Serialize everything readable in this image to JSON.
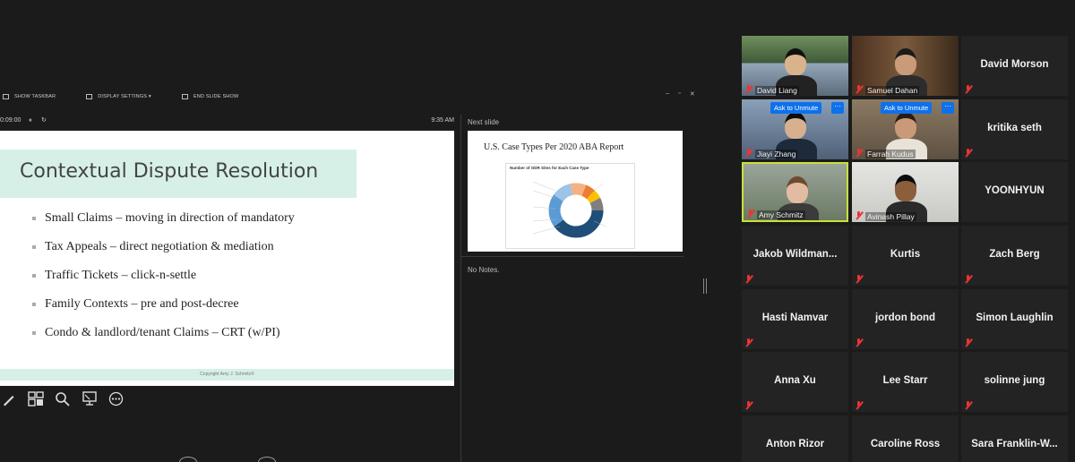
{
  "presenter": {
    "toolbar": {
      "show_taskbar": "SHOW TASKBAR",
      "display_settings": "DISPLAY SETTINGS ▾",
      "end_slide_show": "END SLIDE SHOW",
      "window_controls": [
        "–",
        "▫",
        "✕"
      ]
    },
    "timer": {
      "elapsed": "0:09:00",
      "pause_icon": "⏸",
      "reset_icon": "↻",
      "clock": "9:35 AM"
    },
    "current_slide": {
      "title": "Contextual Dispute Resolution",
      "bullets": [
        "Small Claims – moving in direction of mandatory",
        "Tax Appeals – direct negotiation & mediation",
        "Traffic Tickets – click-n-settle",
        "Family Contexts – pre and post-decree",
        "Condo & landlord/tenant Claims – CRT (w/PI)"
      ],
      "footer": "Copyright Amy J. Schmitz©"
    },
    "tools": [
      "pen-icon",
      "slides-grid-icon",
      "zoom-icon",
      "pointer-icon",
      "more-icon"
    ],
    "next_slide_label": "Next slide",
    "next_slide": {
      "title": "U.S. Case Types Per 2020 ABA Report",
      "chart_title": "Number of ODR Sites for Each Case Type"
    },
    "notes": "No Notes."
  },
  "participants": [
    {
      "name": "David Liang",
      "video": true,
      "muted": true
    },
    {
      "name": "Samuel Dahan",
      "video": true,
      "muted": true
    },
    {
      "name": "David Morson",
      "video": false,
      "muted": true
    },
    {
      "name": "Jiayi Zhang",
      "video": true,
      "muted": true,
      "ask_to_unmute": "Ask to Unmute"
    },
    {
      "name": "Farrah Kudus",
      "video": true,
      "muted": true,
      "ask_to_unmute": "Ask to Unmute"
    },
    {
      "name": "kritika seth",
      "video": false,
      "muted": true
    },
    {
      "name": "Amy Schmitz",
      "video": true,
      "muted": true,
      "active_speaker": true
    },
    {
      "name": "Avinash Pillay",
      "video": true,
      "muted": true
    },
    {
      "name": "YOONHYUN",
      "video": false,
      "muted": false
    },
    {
      "name": "Jakob  Wildman...",
      "video": false,
      "muted": true
    },
    {
      "name": "Kurtis",
      "video": false,
      "muted": true
    },
    {
      "name": "Zach Berg",
      "video": false,
      "muted": true
    },
    {
      "name": "Hasti Namvar",
      "video": false,
      "muted": true
    },
    {
      "name": "jordon bond",
      "video": false,
      "muted": true
    },
    {
      "name": "Simon Laughlin",
      "video": false,
      "muted": true
    },
    {
      "name": "Anna Xu",
      "video": false,
      "muted": true
    },
    {
      "name": "Lee Starr",
      "video": false,
      "muted": true
    },
    {
      "name": "solinne jung",
      "video": false,
      "muted": true
    },
    {
      "name": "Anton Rizor",
      "video": false,
      "muted": false
    },
    {
      "name": "Caroline Ross",
      "video": false,
      "muted": false
    },
    {
      "name": "Sara  Franklin-W...",
      "video": false,
      "muted": false
    }
  ],
  "more_options": "···",
  "colors": {
    "active_speaker": "#c8e23a",
    "unmute_button": "#0e71eb",
    "slide_accent": "#d6f0e8",
    "muted_icon": "#e33333"
  }
}
